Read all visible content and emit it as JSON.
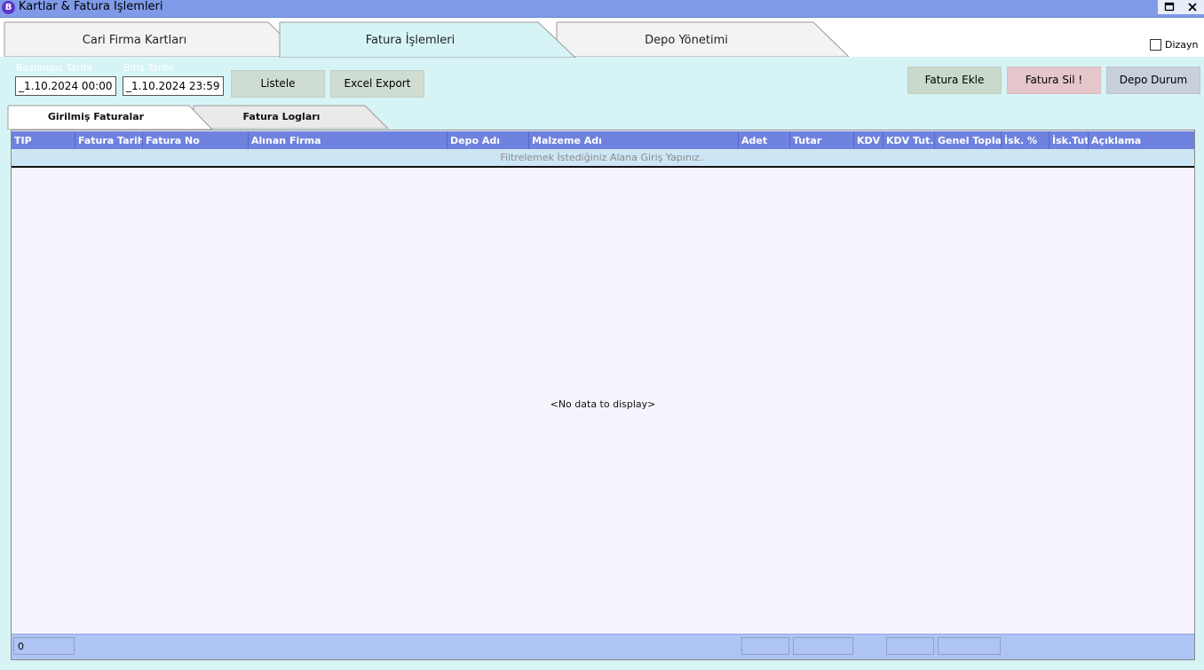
{
  "window": {
    "logo_letter": "B",
    "title": "Kartlar & Fatura İşlemleri",
    "maximize_glyph": "🗖",
    "close_glyph": "✕"
  },
  "main_tabs": [
    {
      "label": "Cari Firma Kartları",
      "active": false
    },
    {
      "label": "Fatura İşlemleri",
      "active": true
    },
    {
      "label": "Depo Yönetimi",
      "active": false
    }
  ],
  "design_toggle": {
    "label": "Dizayn",
    "checked": false
  },
  "filters": {
    "start_label": "Başlangıç Tarihi",
    "start_value": "_1.10.2024 00:00",
    "end_label": "Bitiş Tarihi",
    "end_value": "_1.10.2024 23:59"
  },
  "toolbar": {
    "list_label": "Listele",
    "excel_label": "Excel Export",
    "add_invoice_label": "Fatura Ekle",
    "delete_invoice_label": "Fatura Sil !",
    "depot_status_label": "Depo Durum"
  },
  "inner_tabs": [
    {
      "label": "Girilmiş Faturalar",
      "active": true
    },
    {
      "label": "Fatura Logları",
      "active": false
    }
  ],
  "grid": {
    "columns": [
      "TIP",
      "Fatura Tarihi",
      "Fatura No",
      "Alınan Firma",
      "Depo Adı",
      "Malzeme Adı",
      "Adet",
      "Tutar",
      "KDV",
      "KDV Tut.",
      "Genel Toplam",
      "İsk. %",
      "İsk.Tutar",
      "Açıklama"
    ],
    "filter_placeholder": "Filtrelemek İstediğiniz Alana Giriş Yapınız..",
    "empty_text": "<No data to display>",
    "footer_count": "0"
  },
  "colors": {
    "titlebar": "#7f9be8",
    "header": "#6f82df",
    "footer": "#aec4f4",
    "background": "#d6f4f5",
    "add_button": "#c9d9cb",
    "delete_button": "#e4c6cb",
    "depot_button": "#c8d0dc"
  }
}
